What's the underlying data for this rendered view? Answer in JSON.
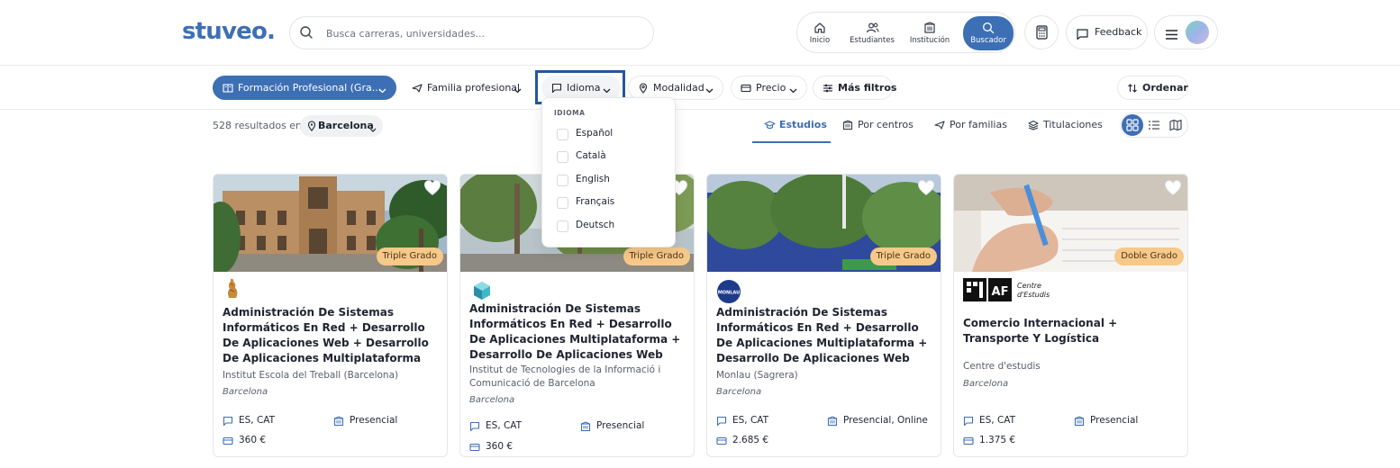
{
  "header": {
    "logo": "stuveo.",
    "search_placeholder": "Busca carreras, universidades...",
    "nav": [
      {
        "label": "Inicio",
        "icon": "home-icon"
      },
      {
        "label": "Estudiantes",
        "icon": "users-icon"
      },
      {
        "label": "Institución",
        "icon": "building-icon"
      },
      {
        "label": "Buscador",
        "icon": "search-icon",
        "active": true
      }
    ],
    "feedback_label": "Feedback",
    "accent_color": "#3d6fb5"
  },
  "filters": {
    "formacion": "Formación Profesional (Gra...",
    "familia": "Familia profesional",
    "idioma": "Idioma",
    "modalidad": "Modalidad",
    "precio": "Precio",
    "mas_filtros": "Más filtros",
    "ordenar": "Ordenar"
  },
  "dropdown": {
    "heading": "IDIOMA",
    "options": [
      "Español",
      "Català",
      "English",
      "Français",
      "Deutsch"
    ]
  },
  "results": {
    "count_text": "528 resultados en",
    "city": "Barcelona"
  },
  "tabs": [
    {
      "label": "Estudios",
      "active": true
    },
    {
      "label": "Por centros"
    },
    {
      "label": "Por familias"
    },
    {
      "label": "Titulaciones"
    }
  ],
  "view_modes": [
    "grid",
    "list",
    "map"
  ],
  "cards": [
    {
      "badge": "Triple Grado",
      "title": "Administración De Sistemas Informáticos En Red + Desarrollo De Aplicaciones Web + Desarrollo De Aplicaciones Multiplataforma",
      "school": "Institut Escola del Treball (Barcelona)",
      "city": "Barcelona",
      "languages": "ES, CAT",
      "modality": "Presencial",
      "price": "360 €"
    },
    {
      "badge": "Triple Grado",
      "title": "Administración De Sistemas Informáticos En Red + Desarrollo De Aplicaciones Multiplataforma + Desarrollo De Aplicaciones Web",
      "school": "Institut de Tecnologies de la Informació i Comunicació de Barcelona",
      "city": "Barcelona",
      "languages": "ES, CAT",
      "modality": "Presencial",
      "price": "360 €"
    },
    {
      "badge": "Triple Grado",
      "title": "Administración De Sistemas Informáticos En Red + Desarrollo De Aplicaciones Multiplataforma + Desarrollo De Aplicaciones Web",
      "school": "Monlau (Sagrera)",
      "city": "Barcelona",
      "languages": "ES, CAT",
      "modality": "Presencial, Online",
      "price": "2.685 €",
      "logo_text": "MONLAU"
    },
    {
      "badge": "Doble Grado",
      "title": "Comercio Internacional + Transporte Y Logística",
      "school": "Centre d'estudis",
      "city": "Barcelona",
      "languages": "ES, CAT",
      "modality": "Presencial",
      "price": "1.375 €",
      "logo_text": [
        "AF",
        "Centre",
        "d'Estudis"
      ]
    }
  ]
}
